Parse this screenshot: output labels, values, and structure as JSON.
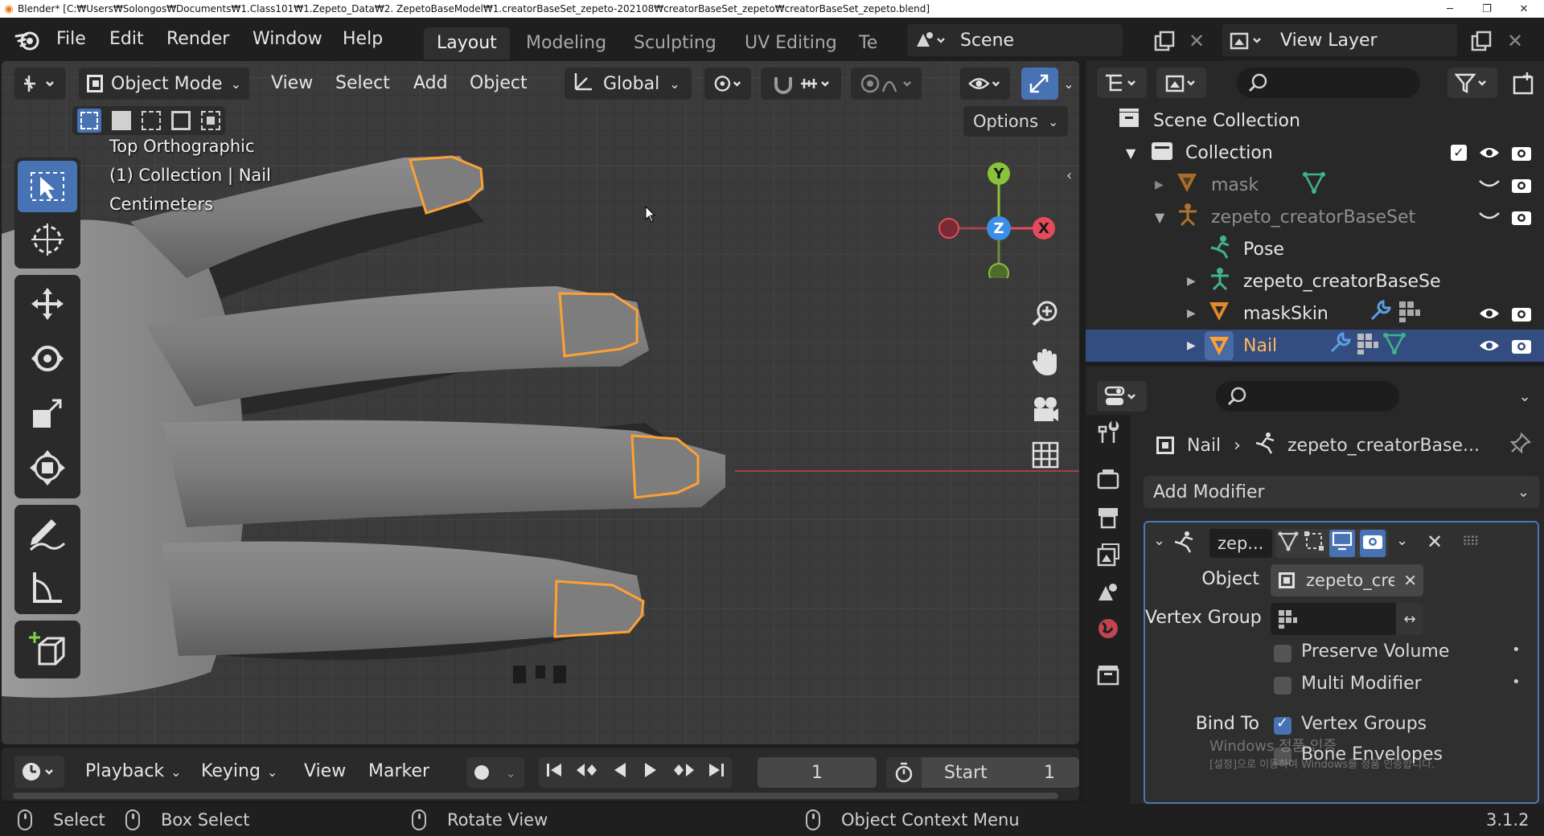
{
  "window": {
    "title": "Blender* [C:₩Users₩Solongos₩Documents₩1.Class101₩1.Zepeto_Data₩2. ZepetoBaseModel₩1.creatorBaseSet_zepeto-202108₩creatorBaseSet_zepeto₩creatorBaseSet_zepeto.blend]"
  },
  "menubar": {
    "items": [
      "File",
      "Edit",
      "Render",
      "Window",
      "Help"
    ],
    "workspaces": [
      "Layout",
      "Modeling",
      "Sculpting",
      "UV Editing",
      "Te"
    ],
    "active_workspace": "Layout",
    "scene": "Scene",
    "view_layer": "View Layer"
  },
  "viewport": {
    "mode": "Object Mode",
    "menus": [
      "View",
      "Select",
      "Add",
      "Object"
    ],
    "orientation": "Global",
    "options_label": "Options",
    "info": [
      "Top Orthographic",
      "(1) Collection | Nail",
      "Centimeters"
    ],
    "gizmo_axes": {
      "y": "Y",
      "z": "Z",
      "x": "X"
    }
  },
  "timeline": {
    "menus": [
      "Playback",
      "Keying",
      "View",
      "Marker"
    ],
    "current_frame": "1",
    "start_label": "Start",
    "start_value": "1"
  },
  "statusbar": {
    "select": "Select",
    "box_select": "Box Select",
    "rotate_view": "Rotate View",
    "context_menu": "Object Context Menu",
    "version": "3.1.2"
  },
  "outliner": {
    "scene_collection": "Scene Collection",
    "items": [
      {
        "label": "Collection"
      },
      {
        "label": "mask"
      },
      {
        "label": "zepeto_creatorBaseSet"
      },
      {
        "label": "Pose"
      },
      {
        "label": "zepeto_creatorBaseSe"
      },
      {
        "label": "maskSkin"
      },
      {
        "label": "Nail"
      }
    ]
  },
  "properties": {
    "breadcrumb_object": "Nail",
    "breadcrumb_modifier": "zepeto_creatorBase...",
    "add_modifier": "Add Modifier",
    "modifier_name": "zep...",
    "object_label": "Object",
    "object_value": "zepeto_cre...",
    "vertex_group_label": "Vertex Group",
    "preserve_volume": "Preserve Volume",
    "multi_modifier": "Multi Modifier",
    "bind_to_label": "Bind To",
    "vertex_groups": "Vertex Groups",
    "bone_envelopes": "Bone Envelopes",
    "watermark_line1": "Windows 정품 인증",
    "watermark_line2": "[설정]으로 이동하여 Windows를 정품 인증합니다."
  },
  "colors": {
    "accent": "#4772b3",
    "selection_outline": "#ffa033",
    "axis_x": "#e54b5d",
    "axis_y": "#8ac23a",
    "axis_z": "#3a8ee6"
  }
}
